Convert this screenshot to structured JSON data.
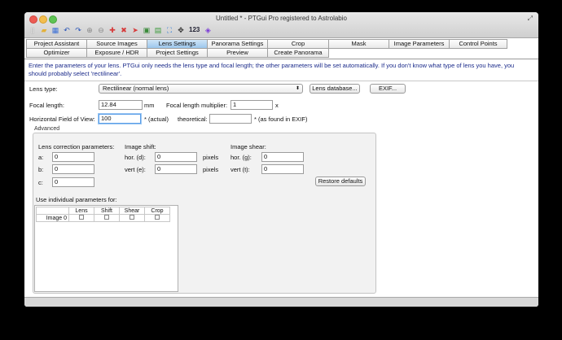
{
  "window": {
    "title": "Untitled * - PTGui Pro registered to Astrolabio"
  },
  "toolbar": {
    "counter": "123"
  },
  "tabs_row1": [
    "Project Assistant",
    "Source Images",
    "Lens Settings",
    "Panorama Settings",
    "Crop",
    "Mask",
    "Image Parameters",
    "Control Points"
  ],
  "tabs_row2": [
    "Optimizer",
    "Exposure / HDR",
    "Project Settings",
    "Preview",
    "Create Panorama"
  ],
  "active_tab": "Lens Settings",
  "intro": "Enter the parameters of your lens. PTGui only needs the lens type and focal length; the other parameters will be set automatically. If you don't know what type of lens you have, you should probably select 'rectilinear'.",
  "lens": {
    "type_label": "Lens type:",
    "type_value": "Rectilinear (normal lens)",
    "database_button": "Lens database...",
    "exif_button": "EXIF...",
    "focal_label": "Focal length:",
    "focal_value": "12.84",
    "focal_unit": "mm",
    "multiplier_label": "Focal length multiplier:",
    "multiplier_value": "1",
    "multiplier_unit": "x",
    "hfov_label": "Horizontal Field of View:",
    "hfov_value": "100",
    "hfov_suffix": "* (actual)",
    "theoretical_label": "theoretical:",
    "theoretical_value": "",
    "theoretical_suffix": "* (as found in EXIF)"
  },
  "advanced": {
    "title": "Advanced",
    "correction_title": "Lens correction parameters:",
    "a_label": "a:",
    "a_value": "0",
    "b_label": "b:",
    "b_value": "0",
    "c_label": "c:",
    "c_value": "0",
    "shift_title": "Image shift:",
    "shift_hor_label": "hor. (d):",
    "shift_hor_value": "0",
    "shift_vert_label": "vert (e):",
    "shift_vert_value": "0",
    "pixels1": "pixels",
    "pixels2": "pixels",
    "shear_title": "Image shear:",
    "shear_hor_label": "hor. (g):",
    "shear_hor_value": "0",
    "shear_vert_label": "vert (t):",
    "shear_vert_value": "0",
    "restore_button": "Restore defaults",
    "individual_title": "Use individual parameters for:",
    "columns": [
      "Lens",
      "Shift",
      "Shear",
      "Crop"
    ],
    "rows": [
      {
        "name": "Image 0"
      }
    ]
  }
}
